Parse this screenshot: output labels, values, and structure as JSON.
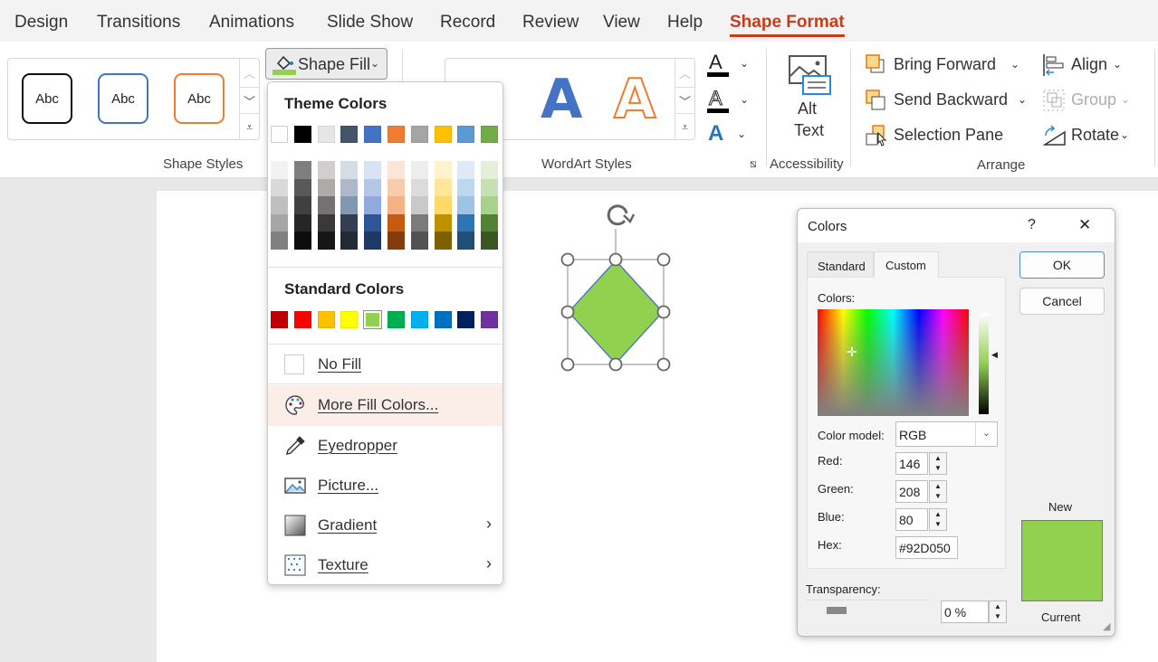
{
  "tabs": [
    {
      "label": "Design"
    },
    {
      "label": "Transitions"
    },
    {
      "label": "Animations"
    },
    {
      "label": "Slide Show"
    },
    {
      "label": "Record"
    },
    {
      "label": "Review"
    },
    {
      "label": "View"
    },
    {
      "label": "Help"
    },
    {
      "label": "Shape Format",
      "active": true
    }
  ],
  "ribbon": {
    "shape_styles": {
      "label": "Shape Styles",
      "samples": [
        "Abc",
        "Abc",
        "Abc"
      ]
    },
    "shape_fill_label": "Shape Fill",
    "shape_fill_color": "#92D050",
    "wordart": {
      "label": "WordArt Styles",
      "samples": [
        "A",
        "A"
      ]
    },
    "accessibility": {
      "label": "Accessibility",
      "alt_text_line1": "Alt",
      "alt_text_line2": "Text"
    },
    "arrange": {
      "label": "Arrange",
      "bring_forward": "Bring Forward",
      "send_backward": "Send Backward",
      "selection_pane": "Selection Pane",
      "align": "Align",
      "group": "Group",
      "rotate": "Rotate"
    }
  },
  "fill_menu": {
    "theme_header": "Theme Colors",
    "theme_colors": [
      "#FFFFFF",
      "#000000",
      "#E7E6E6",
      "#44546A",
      "#4472C4",
      "#ED7D31",
      "#A5A5A5",
      "#FFC000",
      "#5B9BD5",
      "#70AD47"
    ],
    "theme_shades": [
      [
        "#F2F2F2",
        "#D9D9D9",
        "#BFBFBF",
        "#A6A6A6",
        "#808080"
      ],
      [
        "#7F7F7F",
        "#595959",
        "#404040",
        "#262626",
        "#0D0D0D"
      ],
      [
        "#D0CECE",
        "#AEAAAA",
        "#757171",
        "#3A3838",
        "#171616"
      ],
      [
        "#D6DCE5",
        "#ADB9CA",
        "#8497B0",
        "#333F50",
        "#222A35"
      ],
      [
        "#DAE3F3",
        "#B4C7E7",
        "#8FAADC",
        "#2F5597",
        "#203864"
      ],
      [
        "#FBE5D6",
        "#F8CBAD",
        "#F4B183",
        "#C55A11",
        "#843C0C"
      ],
      [
        "#EDEDED",
        "#DBDBDB",
        "#C9C9C9",
        "#7B7B7B",
        "#525252"
      ],
      [
        "#FFF2CC",
        "#FFE699",
        "#FFD966",
        "#BF9000",
        "#7F6000"
      ],
      [
        "#DEEBF7",
        "#BDD7EE",
        "#9DC3E6",
        "#2E75B6",
        "#1F4E79"
      ],
      [
        "#E2F0D9",
        "#C5E0B4",
        "#A9D18E",
        "#548235",
        "#385723"
      ]
    ],
    "standard_header": "Standard Colors",
    "standard_colors": [
      "#C00000",
      "#FF0000",
      "#FFC000",
      "#FFFF00",
      "#92D050",
      "#00B050",
      "#00B0F0",
      "#0070C0",
      "#002060",
      "#7030A0"
    ],
    "selected_standard": "#92D050",
    "items": [
      {
        "label": "No Fill",
        "icon": "no-fill-icon"
      },
      {
        "label": "More Fill Colors...",
        "icon": "palette-icon",
        "highlighted": true
      },
      {
        "label": "Eyedropper",
        "icon": "eyedropper-icon"
      },
      {
        "label": "Picture...",
        "icon": "picture-icon"
      },
      {
        "label": "Gradient",
        "icon": "gradient-icon",
        "submenu": true
      },
      {
        "label": "Texture",
        "icon": "texture-icon",
        "submenu": true
      }
    ]
  },
  "shape": {
    "fill": "#92D050",
    "outline": "#4472C4"
  },
  "dialog": {
    "title": "Colors",
    "help": "?",
    "close": "✕",
    "tabs": [
      "Standard",
      "Custom"
    ],
    "active_tab": "Custom",
    "colors_label": "Colors:",
    "color_model_label": "Color model:",
    "color_model_value": "RGB",
    "red_label": "Red:",
    "red": "146",
    "green_label": "Green:",
    "green": "208",
    "blue_label": "Blue:",
    "blue": "80",
    "hex_label": "Hex:",
    "hex": "#92D050",
    "transparency_label": "Transparency:",
    "transparency": "0 %",
    "ok": "OK",
    "cancel": "Cancel",
    "new_label": "New",
    "current_label": "Current",
    "new_color": "#92D050"
  }
}
